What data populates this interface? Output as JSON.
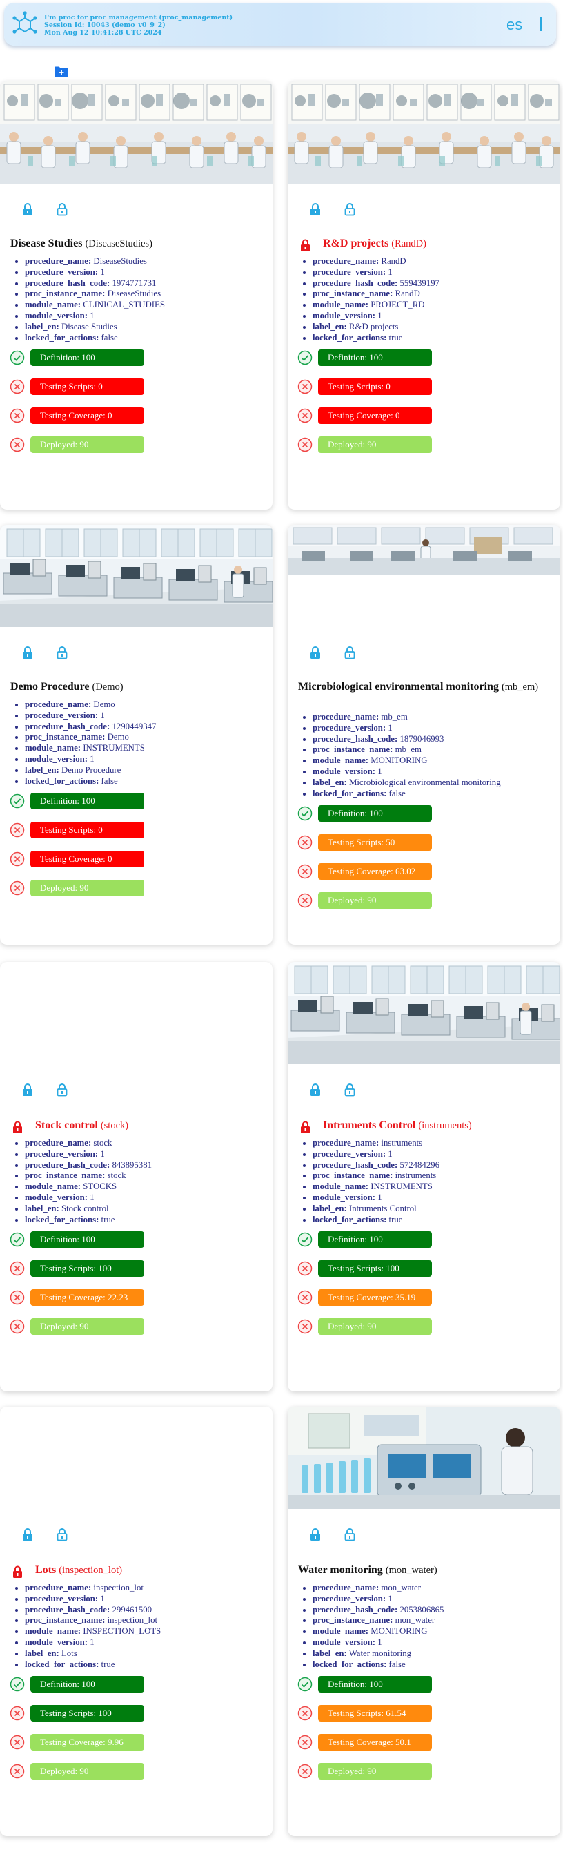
{
  "header": {
    "line1": "I'm proc for proc management (proc_management)",
    "line2": "Session Id: 10043 (demo_v0_9_2)",
    "line3": "Mon Aug 12 10:41:28 UTC 2024",
    "lang": "es"
  },
  "labels": {
    "procedure_name": "procedure_name:",
    "procedure_version": "procedure_version:",
    "procedure_hash_code": "procedure_hash_code:",
    "proc_instance_name": "proc_instance_name:",
    "module_name": "module_name:",
    "module_version": "module_version:",
    "label_en": "label_en:",
    "locked_for_actions": "locked_for_actions:"
  },
  "colors": {
    "accent": "#29a9e1",
    "green": "#007d0e",
    "red": "#ff0000",
    "orange": "#ff8a0d",
    "lime": "#9be05e",
    "locked_title": "#e8161b",
    "prop_text": "#2b2f86"
  },
  "icons": {
    "app_logo": "molecule-logo-icon",
    "new_procedure": "folder-add-icon",
    "lock": "lock-icon",
    "unlock": "unlock-icon",
    "ok": "check-circle-icon",
    "fail": "x-circle-icon"
  },
  "cards": [
    {
      "title": "Disease Studies",
      "subtitle": "(DiseaseStudies)",
      "locked": false,
      "procedure_name": "DiseaseStudies",
      "procedure_version": "1",
      "procedure_hash_code": "1974771731",
      "proc_instance_name": "DiseaseStudies",
      "module_name": "CLINICAL_STUDIES",
      "module_version": "1",
      "label_en": "Disease Studies",
      "locked_for_actions": "false",
      "definition": "Definition: 100",
      "testing_scripts": "Testing Scripts: 0",
      "testing_coverage": "Testing Coverage: 0",
      "deployed": "Deployed: 90"
    },
    {
      "title": "R&D projects",
      "subtitle": "(RandD)",
      "locked": true,
      "procedure_name": "RandD",
      "procedure_version": "1",
      "procedure_hash_code": "559439197",
      "proc_instance_name": "RandD",
      "module_name": "PROJECT_RD",
      "module_version": "1",
      "label_en": "R&D projects",
      "locked_for_actions": "true",
      "definition": "Definition: 100",
      "testing_scripts": "Testing Scripts: 0",
      "testing_coverage": "Testing Coverage: 0",
      "deployed": "Deployed: 90"
    },
    {
      "title": "Demo Procedure",
      "subtitle": "(Demo)",
      "locked": false,
      "procedure_name": "Demo",
      "procedure_version": "1",
      "procedure_hash_code": "1290449347",
      "proc_instance_name": "Demo",
      "module_name": "INSTRUMENTS",
      "module_version": "1",
      "label_en": "Demo Procedure",
      "locked_for_actions": "false",
      "definition": "Definition: 100",
      "testing_scripts": "Testing Scripts: 0",
      "testing_coverage": "Testing Coverage: 0",
      "deployed": "Deployed: 90"
    },
    {
      "title": "Microbiological environmental monitoring",
      "subtitle": "(mb_em)",
      "locked": false,
      "procedure_name": "mb_em",
      "procedure_version": "1",
      "procedure_hash_code": "1879046993",
      "proc_instance_name": "mb_em",
      "module_name": "MONITORING",
      "module_version": "1",
      "label_en": "Microbiological environmental monitoring",
      "locked_for_actions": "false",
      "definition": "Definition: 100",
      "testing_scripts": "Testing Scripts: 50",
      "testing_coverage": "Testing Coverage: 63.02",
      "deployed": "Deployed: 90"
    },
    {
      "title": "Stock control",
      "subtitle": "(stock)",
      "locked": true,
      "procedure_name": "stock",
      "procedure_version": "1",
      "procedure_hash_code": "843895381",
      "proc_instance_name": "stock",
      "module_name": "STOCKS",
      "module_version": "1",
      "label_en": "Stock control",
      "locked_for_actions": "true",
      "definition": "Definition: 100",
      "testing_scripts": "Testing Scripts: 100",
      "testing_coverage": "Testing Coverage: 22.23",
      "deployed": "Deployed: 90"
    },
    {
      "title": "Intruments Control",
      "subtitle": "(instruments)",
      "locked": true,
      "procedure_name": "instruments",
      "procedure_version": "1",
      "procedure_hash_code": "572484296",
      "proc_instance_name": "instruments",
      "module_name": "INSTRUMENTS",
      "module_version": "1",
      "label_en": "Intruments Control",
      "locked_for_actions": "true",
      "definition": "Definition: 100",
      "testing_scripts": "Testing Scripts: 100",
      "testing_coverage": "Testing Coverage: 35.19",
      "deployed": "Deployed: 90"
    },
    {
      "title": "Lots",
      "subtitle": "(inspection_lot)",
      "locked": true,
      "procedure_name": "inspection_lot",
      "procedure_version": "1",
      "procedure_hash_code": "299461500",
      "proc_instance_name": "inspection_lot",
      "module_name": "INSPECTION_LOTS",
      "module_version": "1",
      "label_en": "Lots",
      "locked_for_actions": "true",
      "definition": "Definition: 100",
      "testing_scripts": "Testing Scripts: 100",
      "testing_coverage": "Testing Coverage: 9.96",
      "deployed": "Deployed: 90"
    },
    {
      "title": "Water monitoring",
      "subtitle": "(mon_water)",
      "locked": false,
      "procedure_name": "mon_water",
      "procedure_version": "1",
      "procedure_hash_code": "2053806865",
      "proc_instance_name": "mon_water",
      "module_name": "MONITORING",
      "module_version": "1",
      "label_en": "Water monitoring",
      "locked_for_actions": "false",
      "definition": "Definition: 100",
      "testing_scripts": "Testing Scripts: 61.54",
      "testing_coverage": "Testing Coverage: 50.1",
      "deployed": "Deployed: 90"
    }
  ]
}
